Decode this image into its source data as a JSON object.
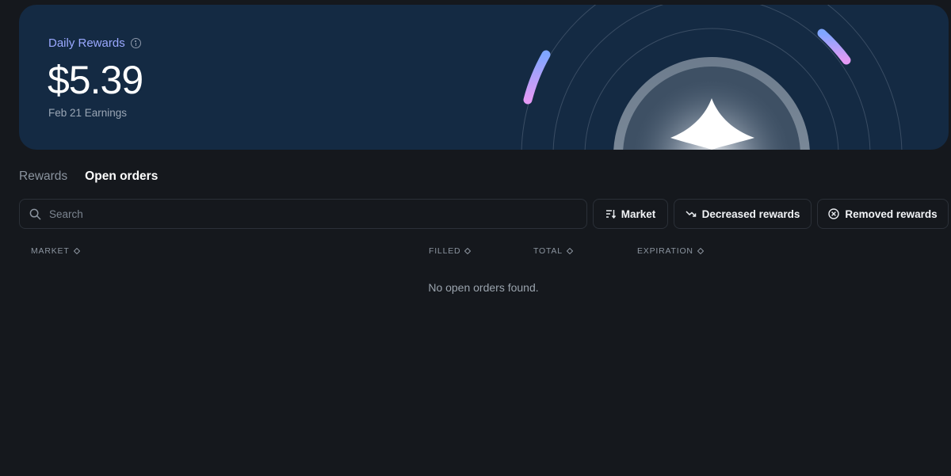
{
  "banner": {
    "label": "Daily Rewards",
    "amount": "$5.39",
    "subtitle": "Feb 21 Earnings",
    "icons": [
      "info-icon",
      "star-icon"
    ]
  },
  "tabs": [
    {
      "label": "Rewards",
      "active": false
    },
    {
      "label": "Open orders",
      "active": true
    }
  ],
  "search": {
    "placeholder": "Search",
    "value": ""
  },
  "filters": {
    "market": "Market",
    "decreased": "Decreased rewards",
    "removed": "Removed rewards"
  },
  "table": {
    "columns": [
      "MARKET",
      "FILLED",
      "TOTAL",
      "EXPIRATION"
    ],
    "empty_message": "No open orders found."
  },
  "colors": {
    "page_bg": "#15181d",
    "banner_bg": "#142a43",
    "accent": "#9aa8ff"
  }
}
